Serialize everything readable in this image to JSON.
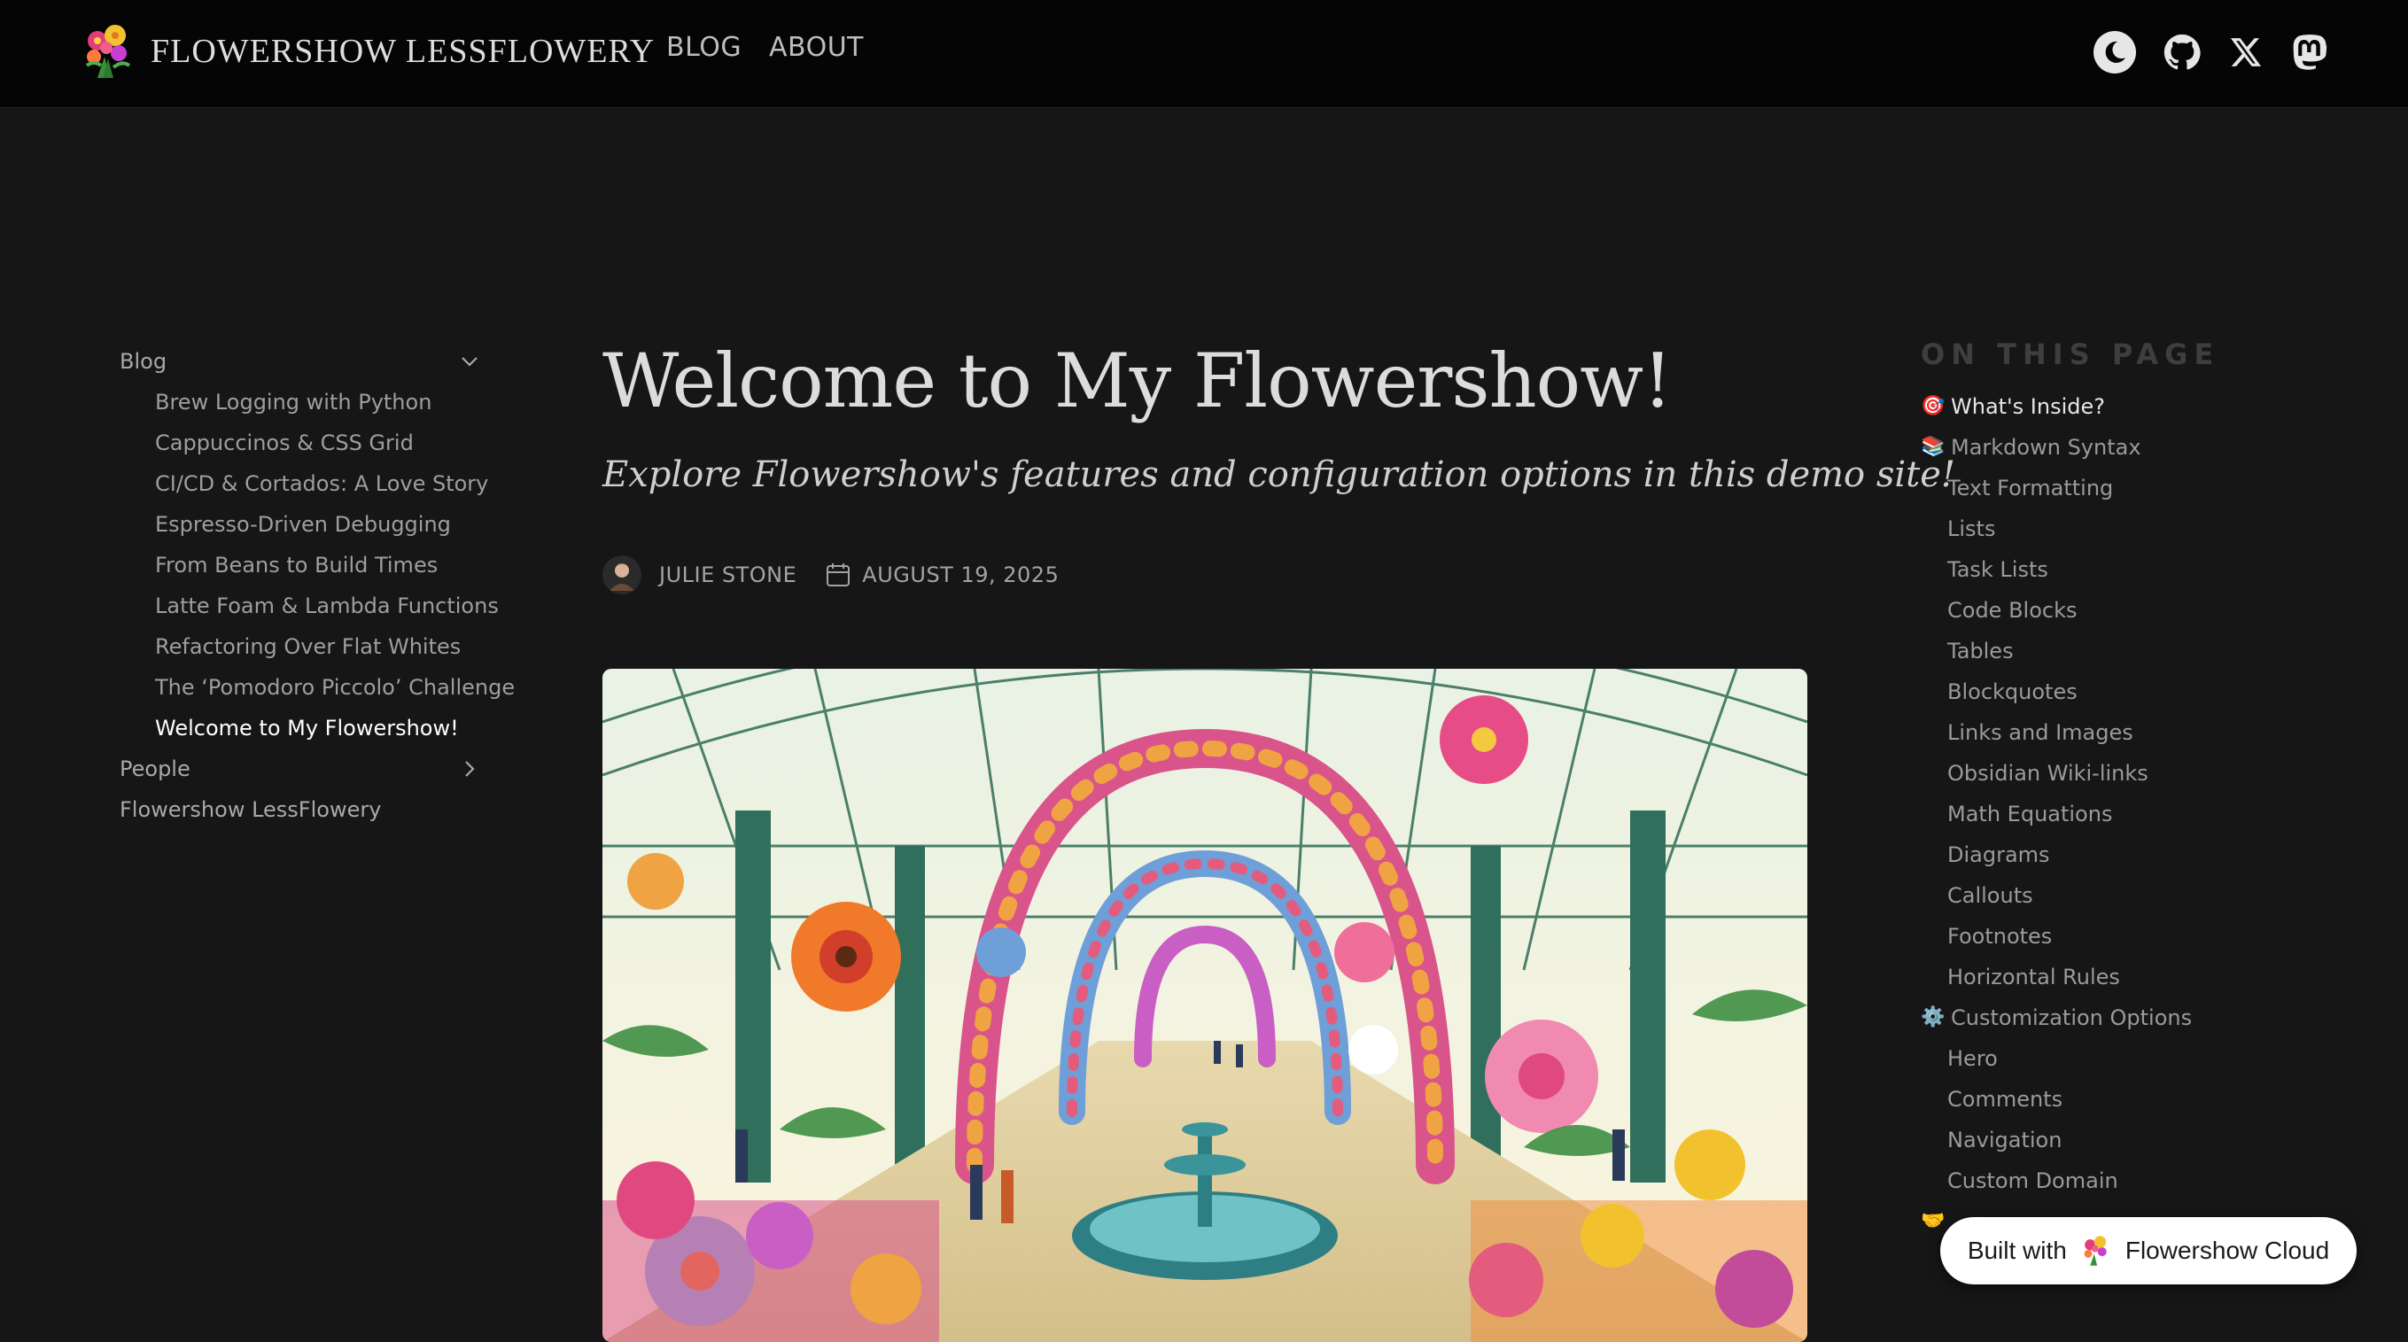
{
  "header": {
    "brand": "FLOWERSHOW LESSFLOWERY",
    "nav": [
      "BLOG",
      "ABOUT"
    ],
    "icons": [
      "moon-icon",
      "github-icon",
      "x-icon",
      "mastodon-icon"
    ]
  },
  "sidebar": {
    "sections": [
      {
        "label": "Blog",
        "expanded": true,
        "items": [
          "Brew Logging with Python",
          "Cappuccinos & CSS Grid",
          "CI/CD & Cortados: A Love Story",
          "Espresso-Driven Debugging",
          "From Beans to Build Times",
          "Latte Foam & Lambda Functions",
          "Refactoring Over Flat Whites",
          "The ‘Pomodoro Piccolo’ Challenge",
          "Welcome to My Flowershow!"
        ],
        "active_item": "Welcome to My Flowershow!"
      },
      {
        "label": "People",
        "expanded": false
      },
      {
        "label": "Flowershow LessFlowery"
      }
    ]
  },
  "article": {
    "title": "Welcome to My Flowershow!",
    "subtitle": "Explore Flowershow's features and configuration options in this demo site!",
    "author": "JULIE STONE",
    "date": "AUGUST 19, 2025"
  },
  "toc": {
    "heading": "ON THIS PAGE",
    "items": [
      {
        "emoji": "🎯",
        "label": "What's Inside?",
        "level": 1,
        "active": true
      },
      {
        "emoji": "📚",
        "label": "Markdown Syntax",
        "level": 1
      },
      {
        "label": "Text Formatting",
        "level": 2
      },
      {
        "label": "Lists",
        "level": 2
      },
      {
        "label": "Task Lists",
        "level": 2
      },
      {
        "label": "Code Blocks",
        "level": 2
      },
      {
        "label": "Tables",
        "level": 2
      },
      {
        "label": "Blockquotes",
        "level": 2
      },
      {
        "label": "Links and Images",
        "level": 2
      },
      {
        "label": "Obsidian Wiki-links",
        "level": 2
      },
      {
        "label": "Math Equations",
        "level": 2
      },
      {
        "label": "Diagrams",
        "level": 2
      },
      {
        "label": "Callouts",
        "level": 2
      },
      {
        "label": "Footnotes",
        "level": 2
      },
      {
        "label": "Horizontal Rules",
        "level": 2
      },
      {
        "emoji": "⚙️",
        "label": "Customization Options",
        "level": 1
      },
      {
        "label": "Hero",
        "level": 2
      },
      {
        "label": "Comments",
        "level": 2
      },
      {
        "label": "Navigation",
        "level": 2
      },
      {
        "label": "Custom Domain",
        "level": 2
      },
      {
        "emoji": "🤝",
        "label": "",
        "level": 1
      }
    ]
  },
  "badge": {
    "prefix": "Built with",
    "name": "Flowershow Cloud"
  },
  "colors": {
    "page_bg": "#161616",
    "topbar_bg": "#050505",
    "badge_bg": "#ffffff"
  }
}
